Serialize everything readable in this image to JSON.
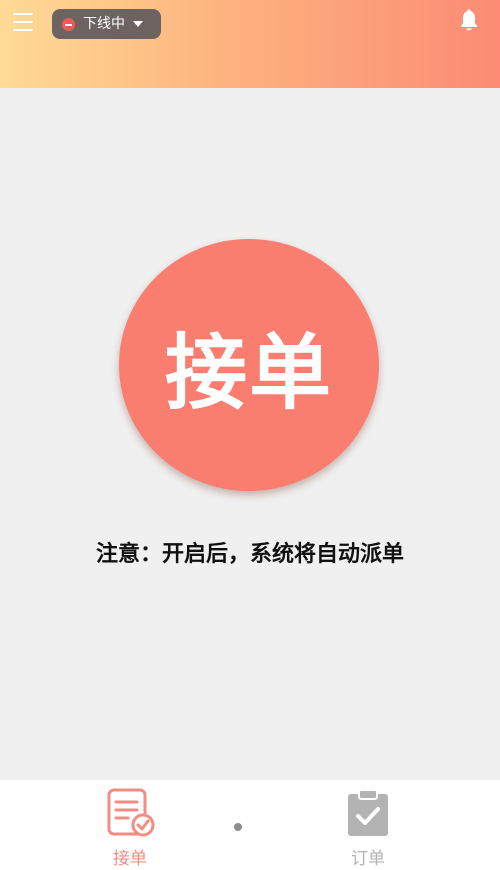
{
  "header": {
    "status": {
      "label": "下线中"
    },
    "gradient": [
      "#fedb94",
      "#fb8b74"
    ]
  },
  "main": {
    "accept_button_label": "接单",
    "notice": "注意：开启后，系统将自动派单",
    "button_color": "#fa7e70"
  },
  "tabbar": {
    "tabs": [
      {
        "label": "接单",
        "icon": "document-check-icon",
        "active": true
      },
      {
        "label": "订单",
        "icon": "clipboard-check-icon",
        "active": false
      }
    ],
    "active_color": "#f28d82",
    "inactive_color": "#b3b3b3"
  }
}
